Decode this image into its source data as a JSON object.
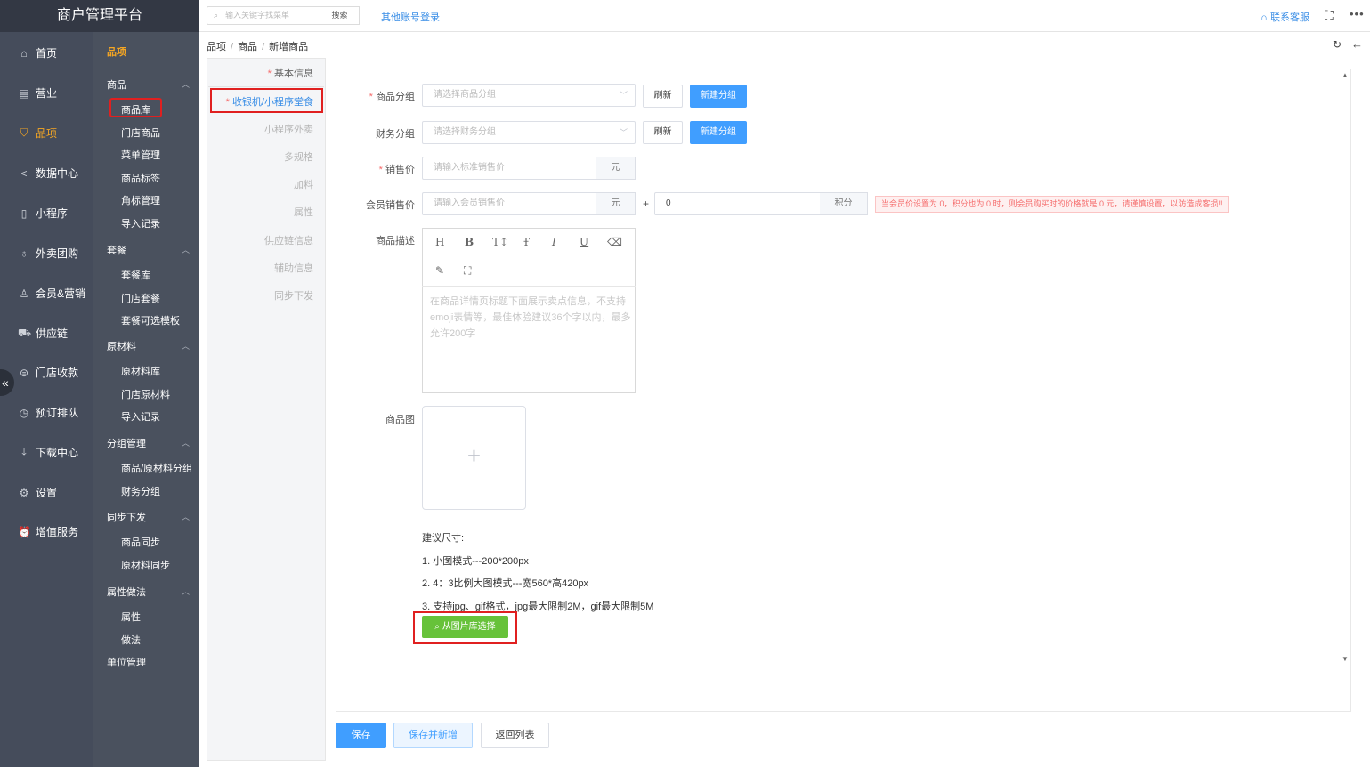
{
  "brand": "商户管理平台",
  "nav": [
    {
      "label": "首页",
      "icon": "home-icon",
      "glyph": "⌂"
    },
    {
      "label": "营业",
      "icon": "calendar-icon",
      "glyph": "▤"
    },
    {
      "label": "品项",
      "icon": "bag-icon",
      "glyph": "⛉"
    },
    {
      "label": "数据中心",
      "icon": "share-icon",
      "glyph": "<"
    },
    {
      "label": "小程序",
      "icon": "phone-icon",
      "glyph": "▯"
    },
    {
      "label": "外卖团购",
      "icon": "bike-icon",
      "glyph": "♁"
    },
    {
      "label": "会员&营销",
      "icon": "user-icon",
      "glyph": "♙"
    },
    {
      "label": "供应链",
      "icon": "truck-icon",
      "glyph": "⛟"
    },
    {
      "label": "门店收款",
      "icon": "wallet-icon",
      "glyph": "⊜"
    },
    {
      "label": "预订排队",
      "icon": "clock-icon",
      "glyph": "◷"
    },
    {
      "label": "下载中心",
      "icon": "download-icon",
      "glyph": "⤓"
    },
    {
      "label": "设置",
      "icon": "gear-icon",
      "glyph": "⚙"
    },
    {
      "label": "增值服务",
      "icon": "alarm-icon",
      "glyph": "⏰"
    }
  ],
  "subnav": {
    "title": "品项",
    "groups": [
      {
        "label": "商品",
        "items": [
          "商品库",
          "门店商品",
          "菜单管理",
          "商品标签",
          "角标管理",
          "导入记录"
        ]
      },
      {
        "label": "套餐",
        "items": [
          "套餐库",
          "门店套餐",
          "套餐可选模板"
        ]
      },
      {
        "label": "原材料",
        "items": [
          "原材料库",
          "门店原材料",
          "导入记录"
        ]
      },
      {
        "label": "分组管理",
        "items": [
          "商品/原材料分组",
          "财务分组"
        ]
      },
      {
        "label": "同步下发",
        "items": [
          "商品同步",
          "原材料同步"
        ]
      },
      {
        "label": "属性做法",
        "items": [
          "属性",
          "做法"
        ]
      },
      {
        "label": "单位管理",
        "items": []
      }
    ]
  },
  "topbar": {
    "search_placeholder": "输入关键字找菜单",
    "search_btn": "搜索",
    "other_login": "其他账号登录",
    "contact": "联系客服"
  },
  "breadcrumb": [
    "品项",
    "商品",
    "新增商品"
  ],
  "anchors": [
    "基本信息",
    "收银机/小程序堂食",
    "小程序外卖",
    "多规格",
    "加料",
    "属性",
    "供应链信息",
    "辅助信息",
    "同步下发"
  ],
  "form": {
    "group_label": "商品分组",
    "group_placeholder": "请选择商品分组",
    "finance_label": "财务分组",
    "finance_placeholder": "请选择财务分组",
    "refresh": "刷新",
    "new_group": "新建分组",
    "price_label": "销售价",
    "price_placeholder": "请输入标准销售价",
    "unit": "元",
    "member_price_label": "会员销售价",
    "member_price_placeholder": "请输入会员销售价",
    "plus": "+",
    "points_value": "0",
    "points_unit": "积分",
    "warning": "当会员价设置为 0，积分也为 0 时，则会员购买时的价格就是 0 元，请谨慎设置，以防造成客损!!",
    "desc_label": "商品描述",
    "desc_placeholder": "在商品详情页标题下面展示卖点信息，不支持emoji表情等，最佳体验建议36个字以内，最多允许200字",
    "image_label": "商品图",
    "upload_plus": "+",
    "hint_title": "建议尺寸:",
    "hint_1": "1. 小图模式---200*200px",
    "hint_2": "2. 4：3比例大图模式---宽560*高420px",
    "hint_3": "3. 支持jpg、gif格式，jpg最大限制2M，gif最大限制5M",
    "pick_from_library": "从图片库选择"
  },
  "toolbar_icons": [
    "H",
    "B",
    "T↕",
    "Ŧ",
    "I",
    "U",
    "⌫",
    "✎",
    "⛶"
  ],
  "actions": {
    "save": "保存",
    "save_new": "保存并新增",
    "back_list": "返回列表"
  }
}
